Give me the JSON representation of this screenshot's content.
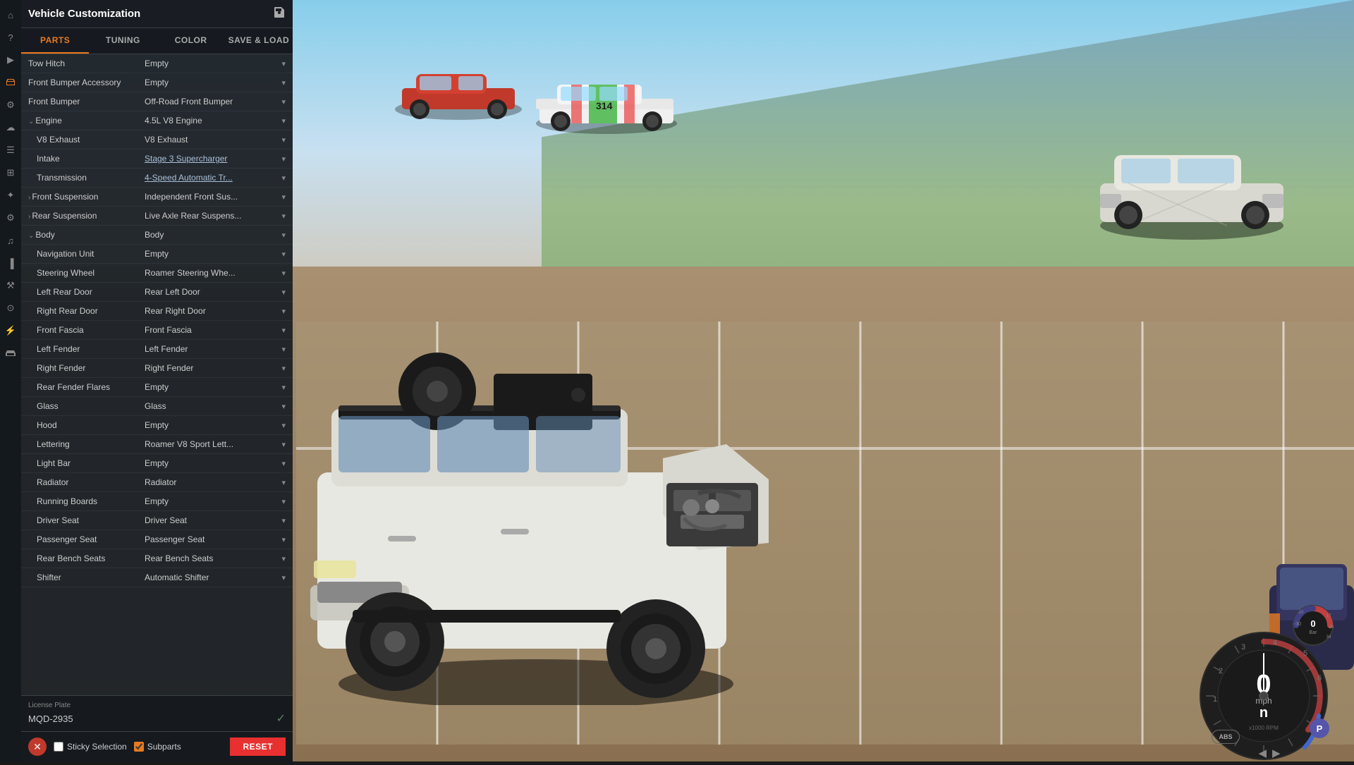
{
  "panel": {
    "title": "Vehicle Customization",
    "tabs": [
      {
        "id": "parts",
        "label": "PARTS",
        "active": true
      },
      {
        "id": "tuning",
        "label": "TUNING",
        "active": false
      },
      {
        "id": "color",
        "label": "COLOR",
        "active": false
      },
      {
        "id": "save-load",
        "label": "SAVE & LOAD",
        "active": false
      }
    ]
  },
  "sideIcons": [
    {
      "name": "home-icon",
      "glyph": "⌂"
    },
    {
      "name": "alert-icon",
      "glyph": "?"
    },
    {
      "name": "play-icon",
      "glyph": "▶"
    },
    {
      "name": "car-icon",
      "glyph": "🚗",
      "active": true
    },
    {
      "name": "settings-icon",
      "glyph": "⚙"
    },
    {
      "name": "cloud-icon",
      "glyph": "☁"
    },
    {
      "name": "list-icon",
      "glyph": "≡"
    },
    {
      "name": "sliders-icon",
      "glyph": "⊞"
    },
    {
      "name": "nodes-icon",
      "glyph": "✦"
    },
    {
      "name": "gear-icon",
      "glyph": "⚙"
    },
    {
      "name": "volume-icon",
      "glyph": "♪"
    },
    {
      "name": "chart-icon",
      "glyph": "📊"
    },
    {
      "name": "tools-icon",
      "glyph": "🔧"
    },
    {
      "name": "camera-icon",
      "glyph": "📷"
    },
    {
      "name": "wrench-icon",
      "glyph": "🔩"
    },
    {
      "name": "vehicle-icon",
      "glyph": "🚙"
    }
  ],
  "parts": [
    {
      "indent": 0,
      "name": "Tow Hitch",
      "value": "Empty",
      "underline": false,
      "expandable": false
    },
    {
      "indent": 0,
      "name": "Front Bumper Accessory",
      "value": "Empty",
      "underline": false,
      "expandable": false
    },
    {
      "indent": 0,
      "name": "Front Bumper",
      "value": "Off-Road Front Bumper",
      "underline": false,
      "expandable": false
    },
    {
      "indent": 0,
      "name": "Engine",
      "value": "4.5L V8 Engine",
      "underline": false,
      "expandable": true,
      "expanded": true
    },
    {
      "indent": 1,
      "name": "V8 Exhaust",
      "value": "V8 Exhaust",
      "underline": false,
      "expandable": false
    },
    {
      "indent": 1,
      "name": "Intake",
      "value": "Stage 3 Supercharger",
      "underline": true,
      "expandable": false
    },
    {
      "indent": 1,
      "name": "Transmission",
      "value": "4-Speed Automatic Tr...",
      "underline": true,
      "expandable": false
    },
    {
      "indent": 0,
      "name": "Front Suspension",
      "value": "Independent Front Sus...",
      "underline": false,
      "expandable": true,
      "expanded": false,
      "collapsed": true
    },
    {
      "indent": 0,
      "name": "Rear Suspension",
      "value": "Live Axle Rear Suspens...",
      "underline": false,
      "expandable": true,
      "expanded": false,
      "collapsed": true
    },
    {
      "indent": 0,
      "name": "Body",
      "value": "Body",
      "underline": false,
      "expandable": true,
      "expanded": true
    },
    {
      "indent": 1,
      "name": "Navigation Unit",
      "value": "Empty",
      "underline": false,
      "expandable": false
    },
    {
      "indent": 1,
      "name": "Steering Wheel",
      "value": "Roamer Steering Whe...",
      "underline": false,
      "expandable": false
    },
    {
      "indent": 1,
      "name": "Left Rear Door",
      "value": "Rear Left Door",
      "underline": false,
      "expandable": false
    },
    {
      "indent": 1,
      "name": "Right Rear Door",
      "value": "Rear Right Door",
      "underline": false,
      "expandable": false
    },
    {
      "indent": 1,
      "name": "Front Fascia",
      "value": "Front Fascia",
      "underline": false,
      "expandable": false
    },
    {
      "indent": 1,
      "name": "Left Fender",
      "value": "Left Fender",
      "underline": false,
      "expandable": false
    },
    {
      "indent": 1,
      "name": "Right Fender",
      "value": "Right Fender",
      "underline": false,
      "expandable": false
    },
    {
      "indent": 1,
      "name": "Rear Fender Flares",
      "value": "Empty",
      "underline": false,
      "expandable": false
    },
    {
      "indent": 1,
      "name": "Glass",
      "value": "Glass",
      "underline": false,
      "expandable": false
    },
    {
      "indent": 1,
      "name": "Hood",
      "value": "Empty",
      "underline": false,
      "expandable": false
    },
    {
      "indent": 1,
      "name": "Lettering",
      "value": "Roamer V8 Sport Lett...",
      "underline": false,
      "expandable": false
    },
    {
      "indent": 1,
      "name": "Light Bar",
      "value": "Empty",
      "underline": false,
      "expandable": false
    },
    {
      "indent": 1,
      "name": "Radiator",
      "value": "Radiator",
      "underline": false,
      "expandable": false
    },
    {
      "indent": 1,
      "name": "Running Boards",
      "value": "Empty",
      "underline": false,
      "expandable": false
    },
    {
      "indent": 1,
      "name": "Driver Seat",
      "value": "Driver Seat",
      "underline": false,
      "expandable": false
    },
    {
      "indent": 1,
      "name": "Passenger Seat",
      "value": "Passenger Seat",
      "underline": false,
      "expandable": false
    },
    {
      "indent": 1,
      "name": "Rear Bench Seats",
      "value": "Rear Bench Seats",
      "underline": false,
      "expandable": false
    },
    {
      "indent": 1,
      "name": "Shifter",
      "value": "Automatic Shifter",
      "underline": false,
      "expandable": false
    }
  ],
  "licensePlate": {
    "label": "License Plate",
    "value": "MQD-2935"
  },
  "bottomBar": {
    "stickyLabel": "Sticky Selection",
    "subpartsLabel": "Subparts",
    "resetLabel": "RESET"
  },
  "speedometer": {
    "speed": "0",
    "unit": "mph",
    "gear": "n",
    "rpmLabel": "x1000 RPM",
    "parkingGear": "P",
    "absLabel": "ABS"
  },
  "boostGauge": {
    "value": "0",
    "unit": "Bar"
  }
}
